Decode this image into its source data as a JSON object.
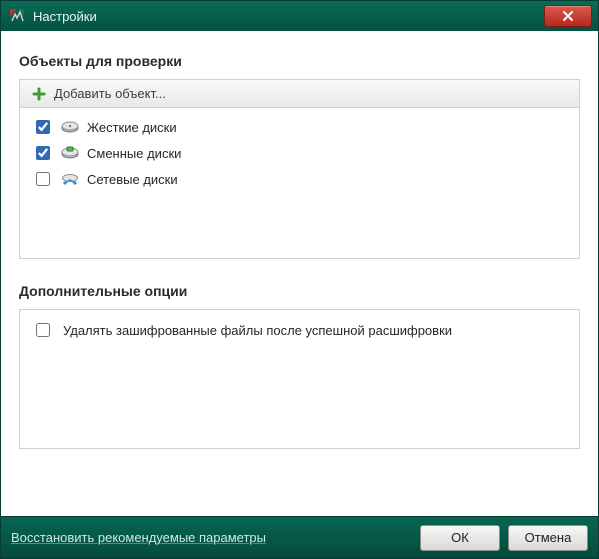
{
  "window": {
    "title": "Настройки"
  },
  "sections": {
    "objects": {
      "title": "Объекты для проверки",
      "add_label": "Добавить объект...",
      "items": [
        {
          "label": "Жесткие диски",
          "checked": true
        },
        {
          "label": "Сменные диски",
          "checked": true
        },
        {
          "label": "Сетевые диски",
          "checked": false
        }
      ]
    },
    "options": {
      "title": "Дополнительные опции",
      "delete_label": "Удалять зашифрованные файлы после успешной расшифровки",
      "delete_checked": false
    }
  },
  "footer": {
    "restore": "Восстановить рекомендуемые параметры",
    "ok": "ОК",
    "cancel": "Отмена"
  }
}
